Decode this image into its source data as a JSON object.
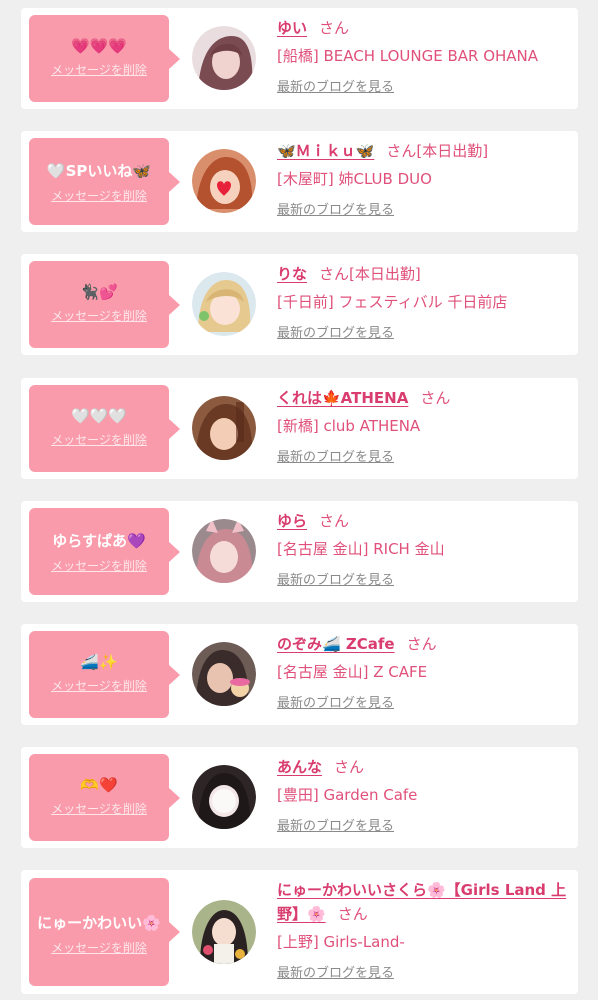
{
  "cards": [
    {
      "message": "💗💗💗",
      "delete_label": "メッセージを削除",
      "name": "ゆい",
      "san": "さん",
      "status": "",
      "shop": "[船橋] BEACH LOUNGE BAR OHANA",
      "blog_label": "最新のブログを見る",
      "avatar_color": "#b89aa2"
    },
    {
      "message": "🤍SPいいね🦋",
      "delete_label": "メッセージを削除",
      "name": "🦋Ｍｉｋｕ🦋",
      "san": "さん",
      "status": "[本日出勤]",
      "shop": "[木屋町] 姉CLUB DUO",
      "blog_label": "最新のブログを見る",
      "avatar_color": "#e2a386"
    },
    {
      "message": "🐈‍⬛💕",
      "delete_label": "メッセージを削除",
      "name": "りな",
      "san": "さん",
      "status": "[本日出勤]",
      "shop": "[千日前] フェスティバル 千日前店",
      "blog_label": "最新のブログを見る",
      "avatar_color": "#e8cfa3"
    },
    {
      "message": "🤍🤍🤍",
      "delete_label": "メッセージを削除",
      "name": "くれは🍁ATHENA",
      "san": "さん",
      "status": "",
      "shop": "[新橋] club ATHENA",
      "blog_label": "最新のブログを見る",
      "avatar_color": "#b07658"
    },
    {
      "message": "ゆらすぱあ💜",
      "delete_label": "メッセージを削除",
      "name": "ゆら",
      "san": "さん",
      "status": "",
      "shop": "[名古屋 金山] RICH 金山",
      "blog_label": "最新のブログを見る",
      "avatar_color": "#caa0a8"
    },
    {
      "message": "🚄✨",
      "delete_label": "メッセージを削除",
      "name": "のぞみ🚄 ZCafe",
      "san": "さん",
      "status": "",
      "shop": "[名古屋 金山] Z CAFE",
      "blog_label": "最新のブログを見る",
      "avatar_color": "#5b4a45"
    },
    {
      "message": "🫶❤️",
      "delete_label": "メッセージを削除",
      "name": "あんな",
      "san": "さん",
      "status": "",
      "shop": "[豊田] Garden Cafe",
      "blog_label": "最新のブログを見る",
      "avatar_color": "#4a3e3e"
    },
    {
      "message": "にゅーかわいい🌸",
      "delete_label": "メッセージを削除",
      "name": "にゅーかわいいさくら🌸【Girls Land 上野】🌸",
      "san": "さん",
      "status": "",
      "shop": "[上野] Girls-Land-",
      "blog_label": "最新のブログを見る",
      "avatar_color": "#7d8a66"
    }
  ],
  "colors": {
    "bubble": "#fa9bab",
    "name": "#d93c6e",
    "text": "#e0507a",
    "link": "#8a8a8a",
    "background": "#efefef"
  }
}
